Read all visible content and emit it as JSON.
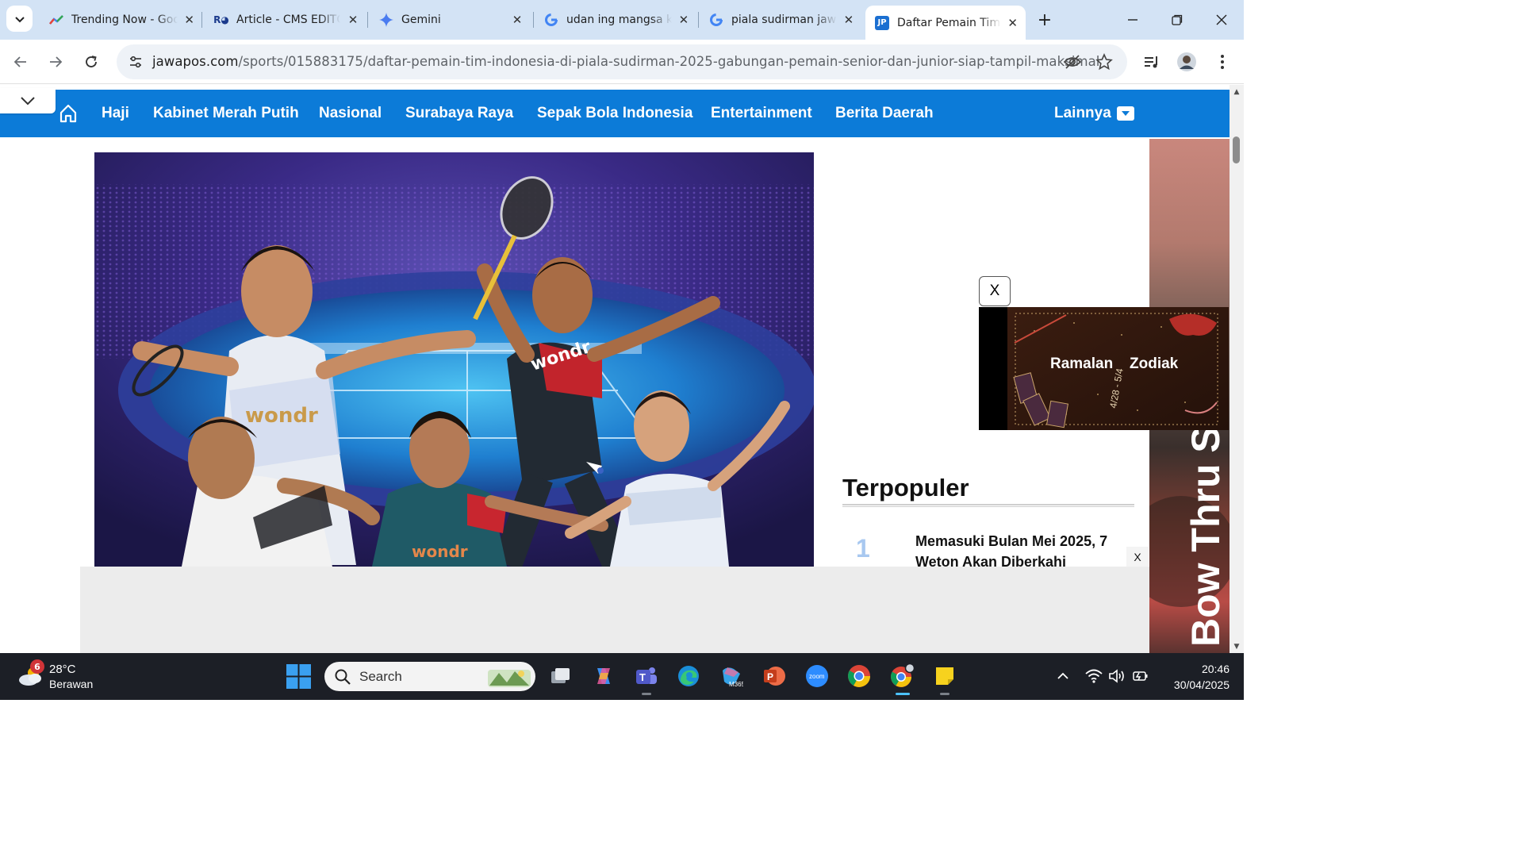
{
  "browser": {
    "tabs": [
      {
        "title": "Trending Now - Google Trends",
        "icon": "google-trends-icon",
        "active": false
      },
      {
        "title": "Article - CMS EDITOR",
        "icon": "cms-icon",
        "active": false
      },
      {
        "title": "Gemini",
        "icon": "gemini-icon",
        "active": false
      },
      {
        "title": "udan ing mangsa ketiga",
        "icon": "google-icon",
        "active": false
      },
      {
        "title": "piala sudirman jawa pos",
        "icon": "google-icon",
        "active": false
      },
      {
        "title": "Daftar Pemain Tim Indonesia",
        "icon": "jawapos-icon",
        "active": true
      }
    ],
    "url_domain": "jawapos.com",
    "url_path": "/sports/015883175/daftar-pemain-tim-indonesia-di-piala-sudirman-2025-gabungan-pemain-senior-dan-junior-siap-tampil-maksimal"
  },
  "site": {
    "nav_items": [
      "Haji",
      "Kabinet Merah Putih",
      "Nasional",
      "Surabaya Raya",
      "Sepak Bola Indonesia",
      "Entertainment",
      "Berita Daerah"
    ],
    "nav_more": "Lainnya",
    "brand_color": "#0c7bd8"
  },
  "hero": {
    "jersey_text": "wondr"
  },
  "ads": {
    "zodiac": {
      "close_label": "X",
      "title_left": "Ramalan",
      "title_right": "Zodiak",
      "date": "4/28 - 5/4"
    },
    "skin_text": "Bow Thru Service",
    "bottom_close_label": "X"
  },
  "sidebar": {
    "popular_heading": "Terpopuler",
    "popular_items": [
      {
        "rank": "1",
        "title": "Memasuki Bulan Mei 2025, 7 Weton Akan Diberkahi"
      }
    ]
  },
  "taskbar": {
    "weather_badge": "6",
    "weather_temp": "28°C",
    "weather_desc": "Berawan",
    "search_placeholder": "Search",
    "time": "20:46",
    "date": "30/04/2025"
  }
}
